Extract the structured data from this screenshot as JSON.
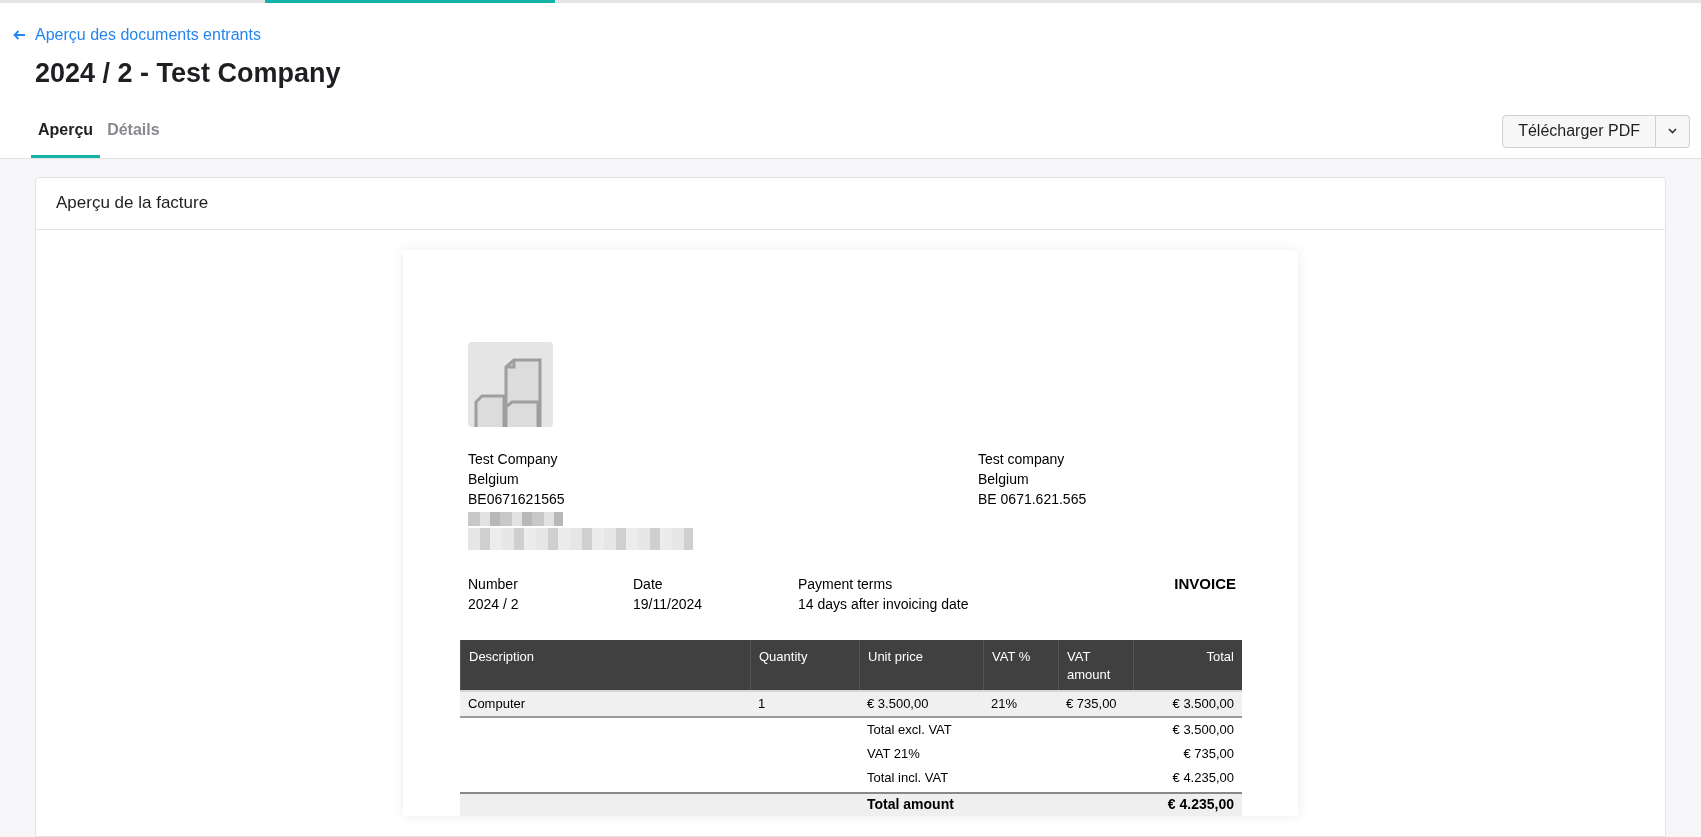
{
  "back_link": "Aperçu des documents entrants",
  "title": "2024 / 2 - Test Company",
  "tabs": [
    {
      "label": "Aperçu",
      "selected": true
    },
    {
      "label": "Détails",
      "selected": false
    }
  ],
  "download_button": {
    "label": "Télécharger PDF"
  },
  "card": {
    "title": "Aperçu de la facture"
  },
  "invoice": {
    "sender": [
      "Test Company",
      "Belgium",
      "BE0671621565"
    ],
    "recipient": [
      "Test company",
      "Belgium",
      "BE 0671.621.565"
    ],
    "meta": [
      {
        "label": "Number",
        "value": "2024 / 2"
      },
      {
        "label": "Date",
        "value": "19/11/2024"
      },
      {
        "label": "Payment terms",
        "value": "14 days after invoicing date"
      }
    ],
    "doc_type": "INVOICE",
    "columns": [
      "Description",
      "Quantity",
      "Unit price",
      "VAT %",
      "VAT amount",
      "Total"
    ],
    "rows": [
      [
        "Computer",
        "1",
        "€ 3.500,00",
        "21%",
        "€ 735,00",
        "€ 3.500,00"
      ]
    ],
    "summary": [
      {
        "kind": "subtotal",
        "label": "Total excl. VAT",
        "value": "€ 3.500,00"
      },
      {
        "kind": "subtotal",
        "label": "VAT 21%",
        "value": "€ 735,00"
      },
      {
        "kind": "subtotal",
        "label": "Total incl. VAT",
        "value": "€ 4.235,00"
      },
      {
        "kind": "grand_total",
        "label": "Total amount",
        "value": "€ 4.235,00"
      }
    ]
  }
}
